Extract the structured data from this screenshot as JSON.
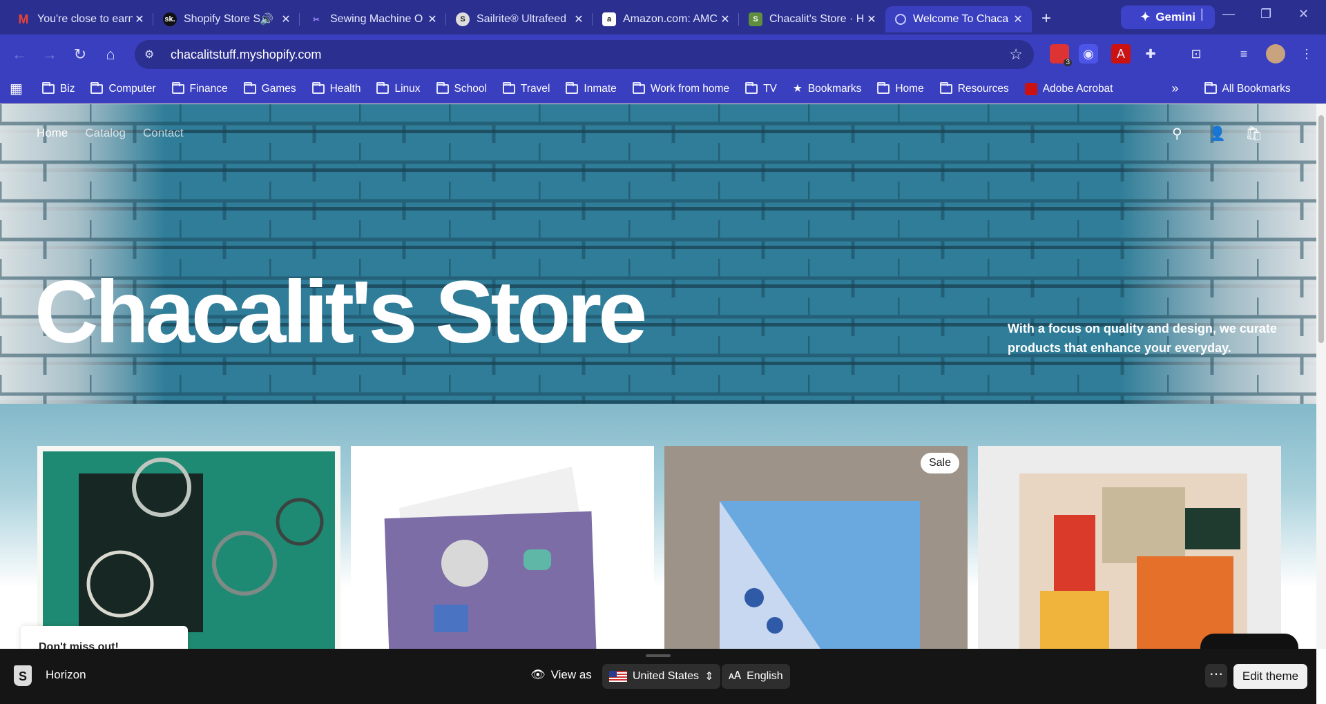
{
  "browser": {
    "tabs": [
      {
        "title": "You're close to earn",
        "icon": "gmail-icon",
        "color": "#ea4335"
      },
      {
        "title": "Shopify Store S",
        "icon": "sk-icon",
        "color": "#111111",
        "audio": true
      },
      {
        "title": "Sewing Machine O",
        "icon": "sewing-icon",
        "color": "#7a5cff"
      },
      {
        "title": "Sailrite® Ultrafeed",
        "icon": "sailrite-icon",
        "color": "#222222"
      },
      {
        "title": "Amazon.com: AMC",
        "icon": "amazon-icon",
        "color": "#ffffff"
      },
      {
        "title": "Chacalit's Store · H",
        "icon": "shopify-icon",
        "color": "#5e8e3e"
      },
      {
        "title": "Welcome To Chaca",
        "icon": "globe-icon",
        "color": "#9aa0ff",
        "active": true
      }
    ],
    "gemini_label": "Gemini",
    "url": "chacalitstuff.myshopify.com",
    "bookmarks": [
      "Biz",
      "Computer",
      "Finance",
      "Games",
      "Health",
      "Linux",
      "School",
      "Travel",
      "Inmate",
      "Work from home",
      "TV",
      "Bookmarks",
      "Home",
      "Resources",
      "Adobe Acrobat"
    ],
    "all_bookmarks": "All Bookmarks",
    "ext_badge": "3"
  },
  "store": {
    "nav": [
      "Home",
      "Catalog",
      "Contact"
    ],
    "title": "Chacalit's Store",
    "tagline": "With a focus on quality and design, we curate products that enhance your everyday.",
    "sale_badge": "Sale",
    "popup_text": "Don't miss out!"
  },
  "footer": {
    "theme_name": "Horizon",
    "view_as": "View as",
    "country": "United States",
    "language": "English",
    "edit_theme": "Edit theme"
  }
}
